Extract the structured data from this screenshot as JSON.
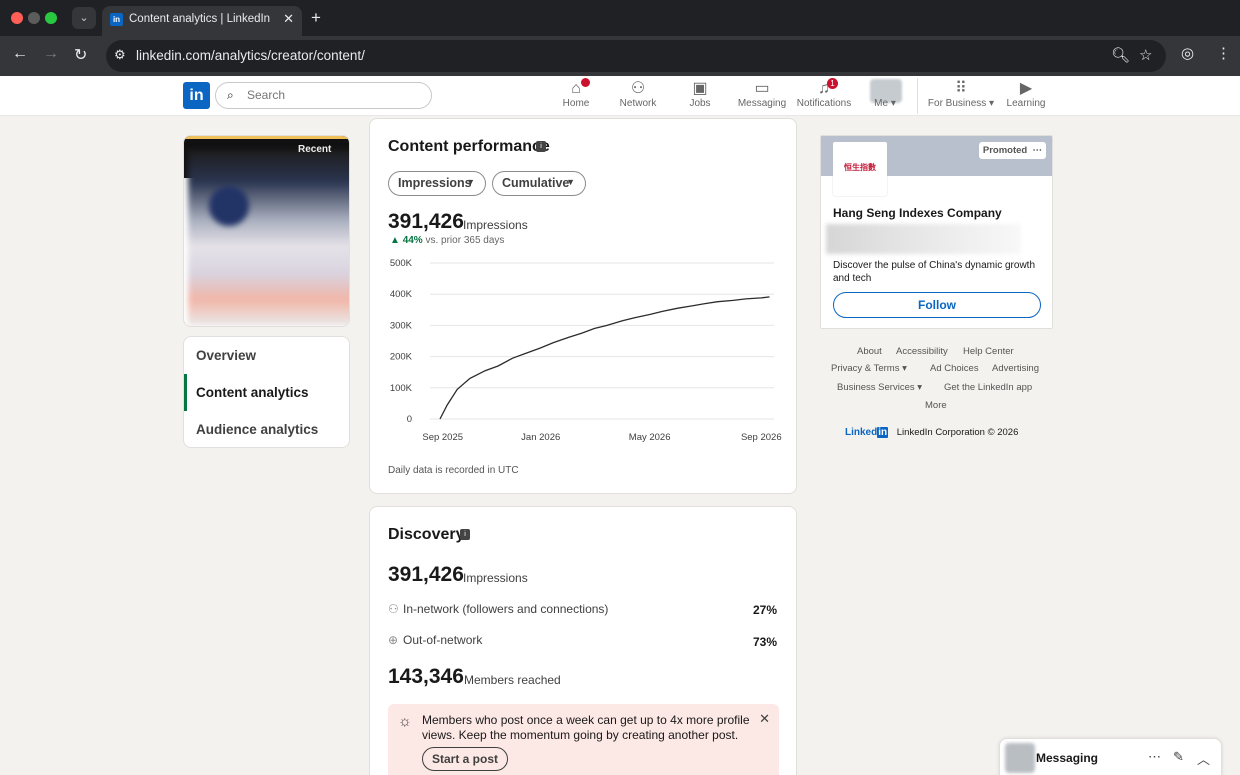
{
  "browser": {
    "tab_title": "Content analytics | LinkedIn",
    "url": "linkedin.com/analytics/creator/content/",
    "colors": {
      "close": "#ff5f57",
      "minimize": "#5c5c5c",
      "maximize": "#28c840"
    }
  },
  "header": {
    "search_placeholder": "Search",
    "nav": [
      {
        "label": "Home",
        "icon": "home-icon"
      },
      {
        "label": "Network",
        "icon": "network-icon"
      },
      {
        "label": "Jobs",
        "icon": "jobs-icon"
      },
      {
        "label": "Messaging",
        "icon": "messaging-icon"
      },
      {
        "label": "Notifications",
        "icon": "bell-icon",
        "badge": "1"
      },
      {
        "label": "Me",
        "icon": "avatar"
      },
      {
        "label": "For Business",
        "icon": "grid-icon"
      },
      {
        "label": "Learning",
        "icon": "learning-icon"
      }
    ]
  },
  "profile": {
    "banner_text": "Recent"
  },
  "sidebar": {
    "items": [
      {
        "label": "Overview",
        "active": false
      },
      {
        "label": "Content analytics",
        "active": true
      },
      {
        "label": "Audience analytics",
        "active": false
      }
    ]
  },
  "performance": {
    "title": "Content performance",
    "metric_dropdown": "Impressions",
    "mode_dropdown": "Cumulative",
    "total": "391,426",
    "total_label": "Impressions",
    "delta": "44%",
    "delta_label": "vs. prior 365 days",
    "footnote": "Daily data is recorded in UTC"
  },
  "chart_data": {
    "type": "line",
    "title": "",
    "xlabel": "",
    "ylabel": "",
    "x_ticks": [
      "Sep 2025",
      "Jan 2026",
      "May 2026",
      "Sep 2026"
    ],
    "y_ticks": [
      "500K",
      "400K",
      "300K",
      "200K",
      "100K",
      "0"
    ],
    "ylim": [
      0,
      500000
    ],
    "xlim": [
      "2025-09-01",
      "2026-09-15"
    ],
    "grid": true,
    "color": "#2c2c2c",
    "x": [
      "2025-09-12",
      "2025-09-20",
      "2025-10-01",
      "2025-10-15",
      "2025-11-01",
      "2025-11-15",
      "2025-12-01",
      "2025-12-15",
      "2026-01-01",
      "2026-01-15",
      "2026-02-01",
      "2026-02-15",
      "2026-03-01",
      "2026-03-15",
      "2026-04-01",
      "2026-04-15",
      "2026-05-01",
      "2026-05-15",
      "2026-06-01",
      "2026-06-15",
      "2026-07-01",
      "2026-07-15",
      "2026-08-01",
      "2026-08-15",
      "2026-09-01",
      "2026-09-10"
    ],
    "y": [
      0,
      45000,
      95000,
      130000,
      155000,
      170000,
      195000,
      210000,
      228000,
      245000,
      262000,
      275000,
      290000,
      300000,
      315000,
      325000,
      335000,
      345000,
      355000,
      362000,
      370000,
      376000,
      380000,
      385000,
      388000,
      391426
    ]
  },
  "discovery": {
    "title": "Discovery",
    "total": "391,426",
    "total_label": "Impressions",
    "in_network_label": "In-network (followers and connections)",
    "in_network_pct": "27%",
    "out_network_label": "Out-of-network",
    "out_network_pct": "73%",
    "members": "143,346",
    "members_label": "Members reached",
    "tip": "Members who post once a week can get up to 4x more profile views. Keep the momentum going by creating another post.",
    "tip_button": "Start a post"
  },
  "ad": {
    "promoted": "Promoted",
    "logo_text": "恒生指數",
    "company": "Hang Seng Indexes Company",
    "description": "Discover the pulse of China's dynamic growth and tech",
    "follow": "Follow"
  },
  "footer": {
    "links": [
      "About",
      "Accessibility",
      "Help Center",
      "Privacy & Terms",
      "Ad Choices",
      "Advertising",
      "Business Services",
      "Get the LinkedIn app",
      "More"
    ],
    "brand": "LinkedIn Corporation © 2026"
  },
  "messaging": {
    "label": "Messaging"
  }
}
